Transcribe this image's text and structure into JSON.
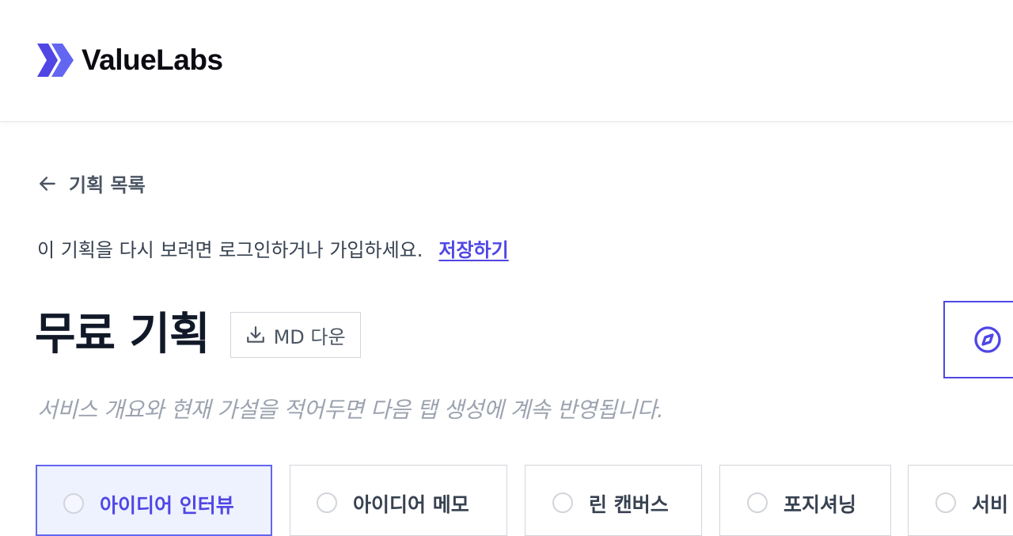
{
  "header": {
    "brand": "ValueLabs",
    "logo_icon": "double-chevron-logo-icon"
  },
  "nav": {
    "back_label": "기획 목록",
    "back_icon": "arrow-left-icon"
  },
  "notice": {
    "text": "이 기획을 다시 보려면 로그인하거나 가입하세요.",
    "save_label": "저장하기"
  },
  "page": {
    "title": "무료 기획",
    "md_button_label": "MD 다운",
    "md_button_icon": "download-icon",
    "compass_icon": "compass-icon",
    "subtitle": "서비스 개요와 현재 가설을 적어두면 다음 탭 생성에 계속 반영됩니다."
  },
  "tabs": [
    {
      "label": "아이디어 인터뷰",
      "active": true
    },
    {
      "label": "아이디어 메모",
      "active": false
    },
    {
      "label": "린 캔버스",
      "active": false
    },
    {
      "label": "포지셔닝",
      "active": false
    },
    {
      "label": "서비",
      "active": false
    }
  ],
  "colors": {
    "accent": "#4f46e5",
    "active_tab_bg": "#eef2ff",
    "logo": "#4f46e5"
  }
}
